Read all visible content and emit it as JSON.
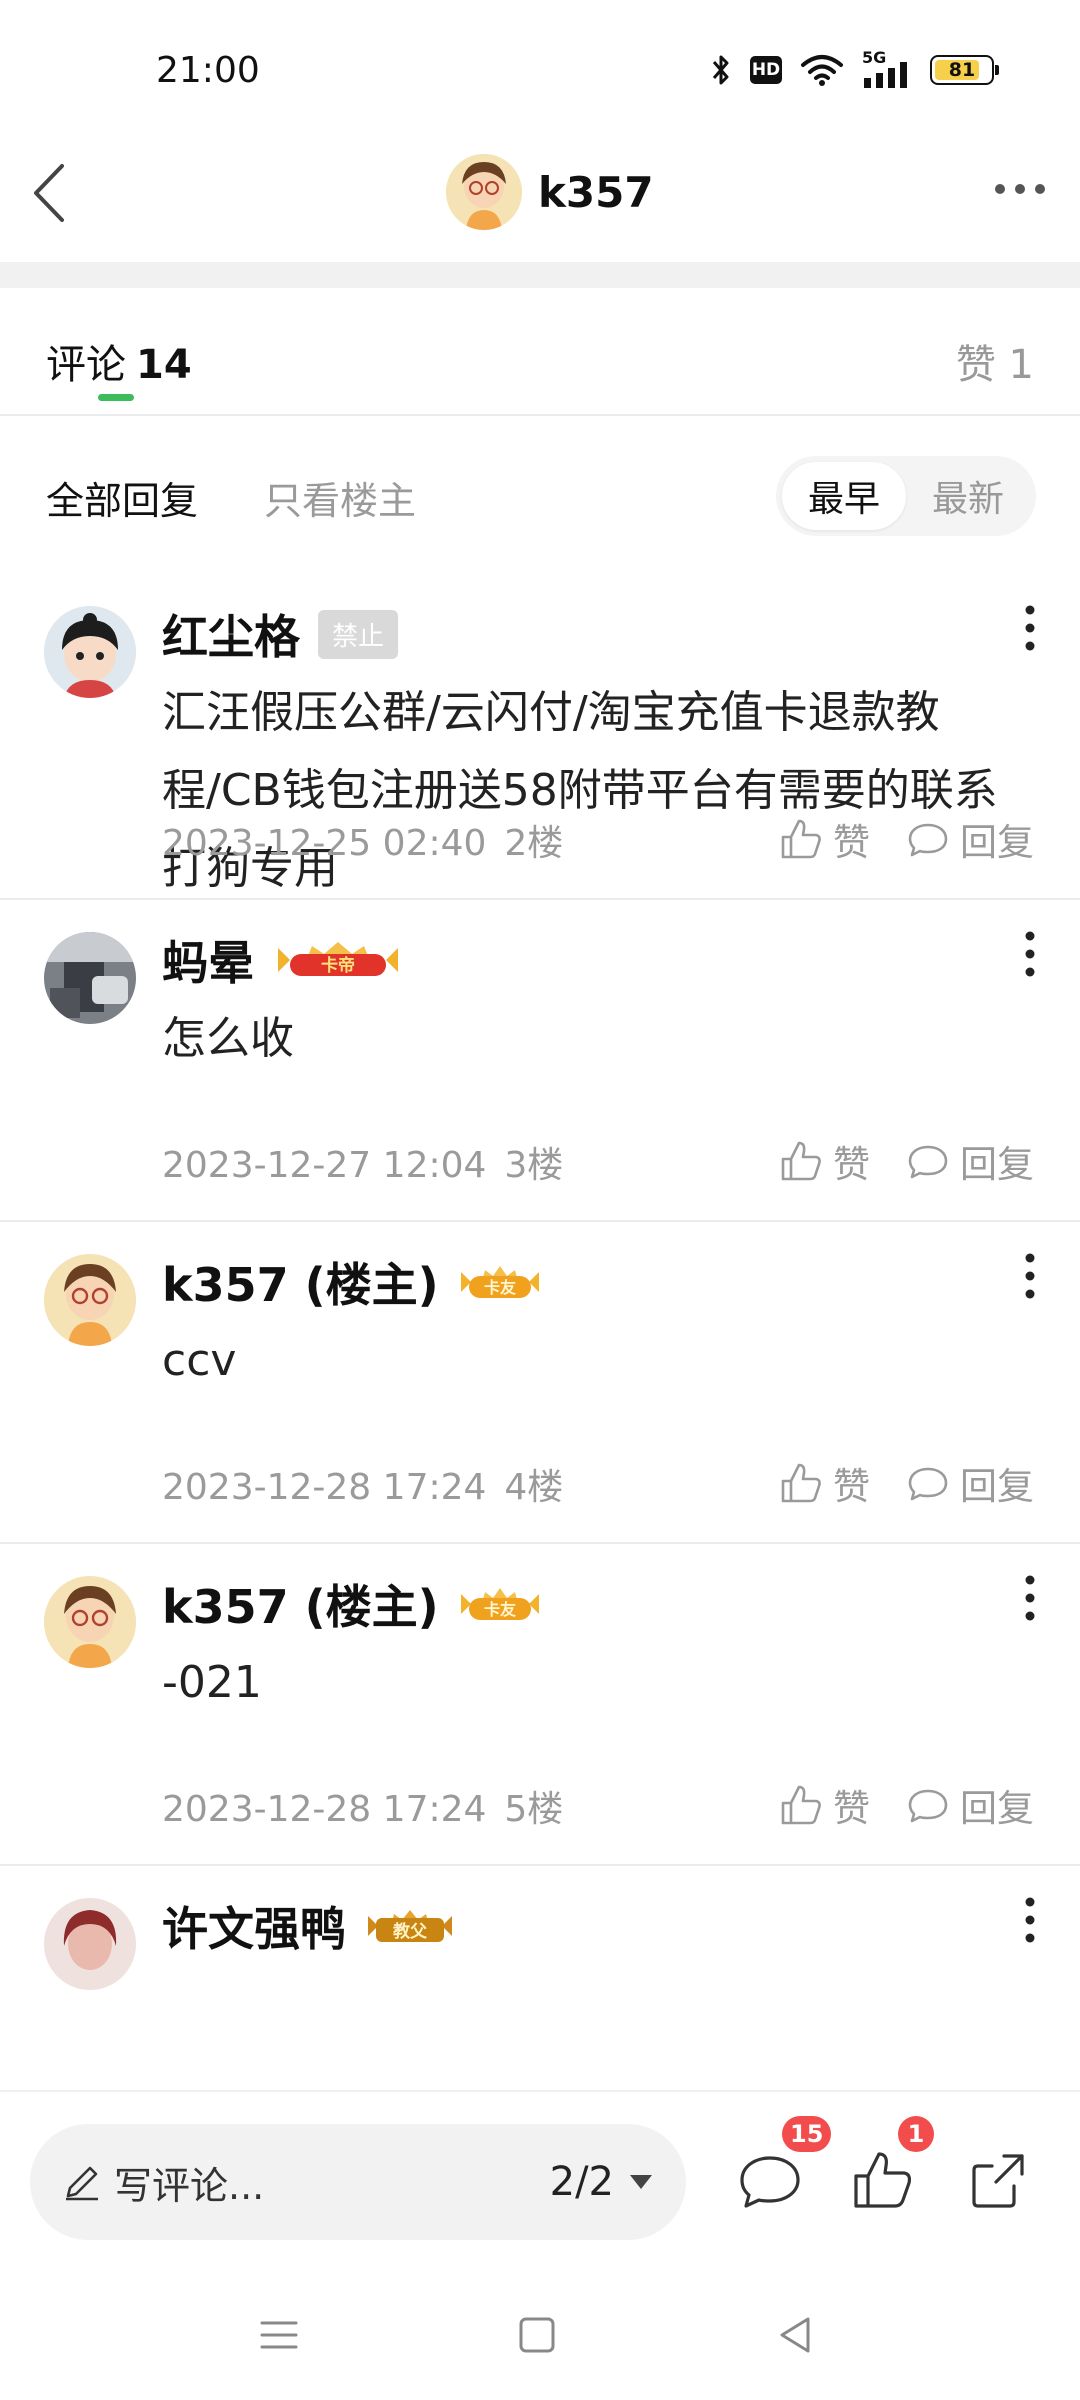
{
  "status_bar": {
    "time": "21:00",
    "hd_label": "HD",
    "network": "5G",
    "battery": "81",
    "battery_level": 0.81
  },
  "header": {
    "title": "k357",
    "icons": [
      "back-arrow-icon",
      "more-icon"
    ]
  },
  "comment_tabs": {
    "label": "评论",
    "count": "14",
    "likes_label": "赞 1"
  },
  "filter": {
    "all": "全部回复",
    "owner_only": "只看楼主",
    "sort": [
      "最早",
      "最新"
    ],
    "sort_selected": "最早"
  },
  "comments": [
    {
      "name": "红尘格",
      "badge_text": "禁止",
      "badge_type": "ban",
      "text": "汇汪假压公群/云闪付/淘宝充值卡退款教程/CB钱包注册送58附带平台有需要的联系打狗专用",
      "date": "2023-12-25 02:40",
      "floor": "2楼",
      "like": "赞",
      "reply": "回复"
    },
    {
      "name": "蚂晕",
      "badge_text": "卡帝",
      "badge_type": "crown-red",
      "text": "怎么收",
      "date": "2023-12-27 12:04",
      "floor": "3楼",
      "like": "赞",
      "reply": "回复"
    },
    {
      "name": "k357 (楼主)",
      "badge_text": "卡友",
      "badge_type": "crown-gold",
      "text": "ccv",
      "date": "2023-12-28 17:24",
      "floor": "4楼",
      "like": "赞",
      "reply": "回复"
    },
    {
      "name": "k357 (楼主)",
      "badge_text": "卡友",
      "badge_type": "crown-gold",
      "text": "-021",
      "date": "2023-12-28 17:24",
      "floor": "5楼",
      "like": "赞",
      "reply": "回复"
    },
    {
      "name": "许文强鸭",
      "badge_text": "教父",
      "badge_type": "crown-gold"
    }
  ],
  "bottom_bar": {
    "placeholder": "写评论...",
    "page": "2/2",
    "comment_badge": "15",
    "like_badge": "1"
  },
  "colors": {
    "accent_green": "#3cbc5a",
    "badge_red": "#f24c4c",
    "muted": "#9a9a9a"
  }
}
